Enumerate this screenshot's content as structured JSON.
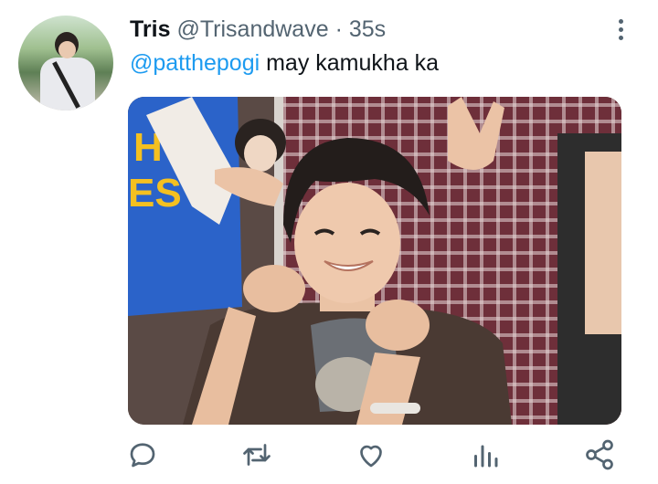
{
  "tweet": {
    "display_name": "Tris",
    "handle": "@Trisandwave",
    "separator": "·",
    "timestamp": "35s",
    "mention": "@patthepogi",
    "text": " may kamukha ka"
  },
  "media": {
    "description_icon": "photo",
    "colors": {
      "accent": "#1d9bf0",
      "muted": "#536471"
    }
  },
  "actions": {
    "icons": [
      "reply-icon",
      "retweet-icon",
      "like-icon",
      "views-icon",
      "share-icon"
    ]
  }
}
